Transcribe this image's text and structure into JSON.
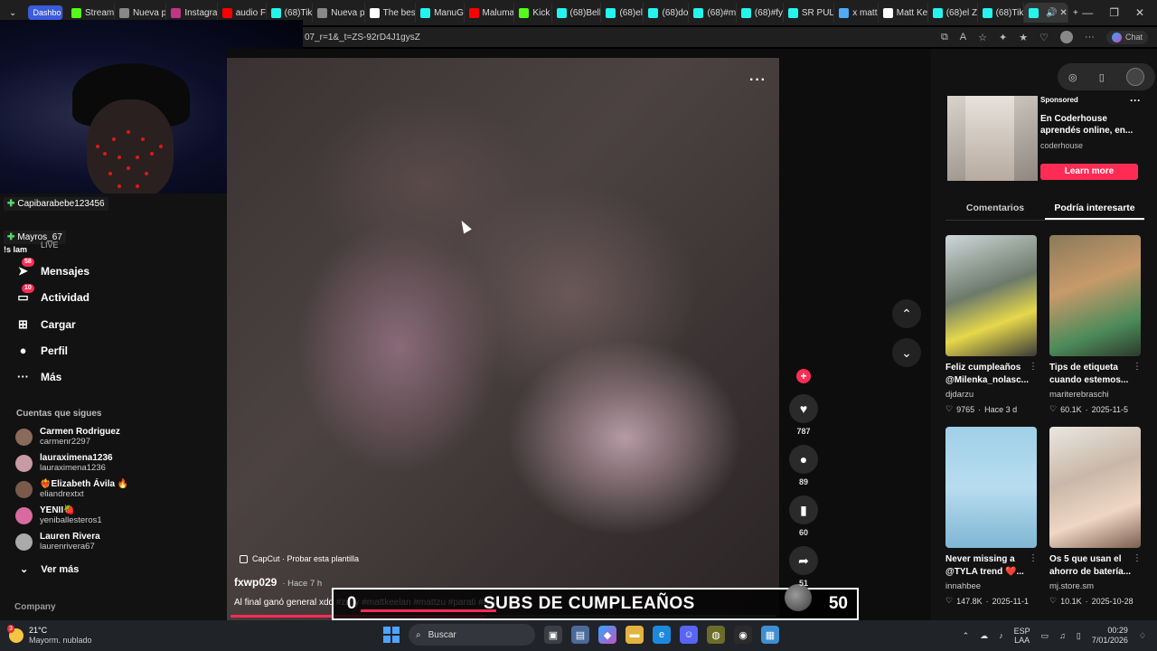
{
  "browser": {
    "tabs": [
      {
        "label": "Dashbo",
        "group": true
      },
      {
        "label": "Stream",
        "icon": "k",
        "color": "#53fc18"
      },
      {
        "label": "Nueva p",
        "icon": "n",
        "color": "#888888"
      },
      {
        "label": "Instagra",
        "icon": "ig",
        "color": "#c13584"
      },
      {
        "label": "audio F",
        "icon": "yt",
        "color": "#ff0000"
      },
      {
        "label": "(68)Tik",
        "icon": "tt",
        "color": "#25f4ee"
      },
      {
        "label": "Nueva p",
        "icon": "n",
        "color": "#888888"
      },
      {
        "label": "The bes",
        "icon": "th",
        "color": "#ffffff"
      },
      {
        "label": "ManuG",
        "icon": "tt",
        "color": "#25f4ee"
      },
      {
        "label": "Maluma",
        "icon": "yt",
        "color": "#ff0000"
      },
      {
        "label": "Kick",
        "icon": "k",
        "color": "#53fc18"
      },
      {
        "label": "(68)Bell",
        "icon": "tt",
        "color": "#25f4ee"
      },
      {
        "label": "(68)el",
        "icon": "tt",
        "color": "#25f4ee"
      },
      {
        "label": "(68)do",
        "icon": "tt",
        "color": "#25f4ee"
      },
      {
        "label": "(68)#m",
        "icon": "tt",
        "color": "#25f4ee"
      },
      {
        "label": "(68)#fy",
        "icon": "tt",
        "color": "#25f4ee"
      },
      {
        "label": "SR PUL",
        "icon": "tt",
        "color": "#25f4ee"
      },
      {
        "label": "x matt",
        "icon": "q",
        "color": "#4dabf7"
      },
      {
        "label": "Matt Ke",
        "icon": "x",
        "color": "#ffffff"
      },
      {
        "label": "(68)el Z",
        "icon": "tt",
        "color": "#25f4ee"
      },
      {
        "label": "(68)Tik",
        "icon": "tt",
        "color": "#25f4ee"
      },
      {
        "label": "",
        "icon": "tt",
        "color": "#25f4ee",
        "active": true
      }
    ],
    "url": "07_r=1&_t=ZS-92rD4J1gysZ",
    "chat_label": "Chat"
  },
  "chat_overlay": {
    "msg1": "Capibarabebe123456",
    "msg2": "Mayros_67",
    "live_label": "LIVE",
    "fragment": "!s lam"
  },
  "nav": {
    "items": [
      {
        "label": "Mensajes",
        "icon": "send-icon",
        "glyph": "➤",
        "badge": "58"
      },
      {
        "label": "Actividad",
        "icon": "inbox-icon",
        "glyph": "▭",
        "badge": "10"
      },
      {
        "label": "Cargar",
        "icon": "upload-icon",
        "glyph": "⊞",
        "badge": ""
      },
      {
        "label": "Perfil",
        "icon": "profile-icon",
        "glyph": "●",
        "badge": ""
      },
      {
        "label": "Más",
        "icon": "more-icon",
        "glyph": "···",
        "badge": ""
      }
    ],
    "following_title": "Cuentas que sigues",
    "following": [
      {
        "name": "Carmen Rodriguez",
        "handle": "carmenr2297"
      },
      {
        "name": "lauraximena1236",
        "handle": "lauraximena1236"
      },
      {
        "name": "❤️‍🔥Elizabeth Ávila 🔥",
        "handle": "eliandrextxt"
      },
      {
        "name": "YENII🍓",
        "handle": "yeniballesteros1"
      },
      {
        "name": "Lauren Rivera",
        "handle": "laurenrivera67"
      }
    ],
    "see_more": "Ver más",
    "company": "Company"
  },
  "video": {
    "capcut": "CapCut · Probar esta plantilla",
    "author": "fxwp029",
    "time": "· Hace 7 h",
    "caption": "Al final ganó general xdd #zully #mattkeelan #mattzu #parati #fyp",
    "progress": 0.47
  },
  "actions": [
    {
      "icon": "heart-icon",
      "glyph": "♥",
      "count": "787"
    },
    {
      "icon": "comment-icon",
      "glyph": "●",
      "count": "89"
    },
    {
      "icon": "bookmark-icon",
      "glyph": "▮",
      "count": "60"
    },
    {
      "icon": "share-icon",
      "glyph": "➦",
      "count": "51"
    }
  ],
  "subs": {
    "current": "0",
    "title": "SUBS DE CUMPLEAÑOS",
    "goal": "50"
  },
  "right": {
    "sponsored": "Sponsored",
    "ad_title": "En Coderhouse aprendés online, en...",
    "ad_author": "coderhouse",
    "learn_more": "Learn more",
    "tab_comments": "Comentarios",
    "tab_suggested": "Podría interesarte",
    "cards": [
      {
        "title": "Feliz cumpleaños\n@Milenka_nolasc...",
        "author": "djdarzu",
        "likes": "9765",
        "date": "Hace 3 d",
        "bg": "linear-gradient(160deg,#cfd7da 0%,#6c7a6a 45%,#e6d84a 70%,#3a3a3a 100%)"
      },
      {
        "title": "Tips de etiqueta\ncuando estemos...",
        "author": "mariterebraschi",
        "likes": "60.1K",
        "date": "2025-11-5",
        "bg": "linear-gradient(160deg,#8a7a5a 0%,#c79a6a 40%,#4c8a5a 75%,#2d3a2a 100%)"
      },
      {
        "title": "Never missing a\n@TYLA trend ❤️...",
        "author": "innahbee",
        "likes": "147.8K",
        "date": "2025-11-1",
        "bg": "linear-gradient(180deg,#9fd0e8 0%,#b8dcee 50%,#7fb6d4 100%)"
      },
      {
        "title": "Os 5 que usan el\nahorro de batería...",
        "author": "mj.store.sm",
        "likes": "10.1K",
        "date": "2025-10-28",
        "bg": "linear-gradient(160deg,#e9e6e1 0%,#c9b8a8 40%,#f0d6c4 70%,#7a5f50 100%)"
      }
    ]
  },
  "taskbar": {
    "temp": "21°C",
    "weather": "Mayorm. nublado",
    "search_placeholder": "Buscar",
    "lang1": "ESP",
    "lang2": "LAA",
    "time": "00:29",
    "date": "7/01/2026"
  }
}
